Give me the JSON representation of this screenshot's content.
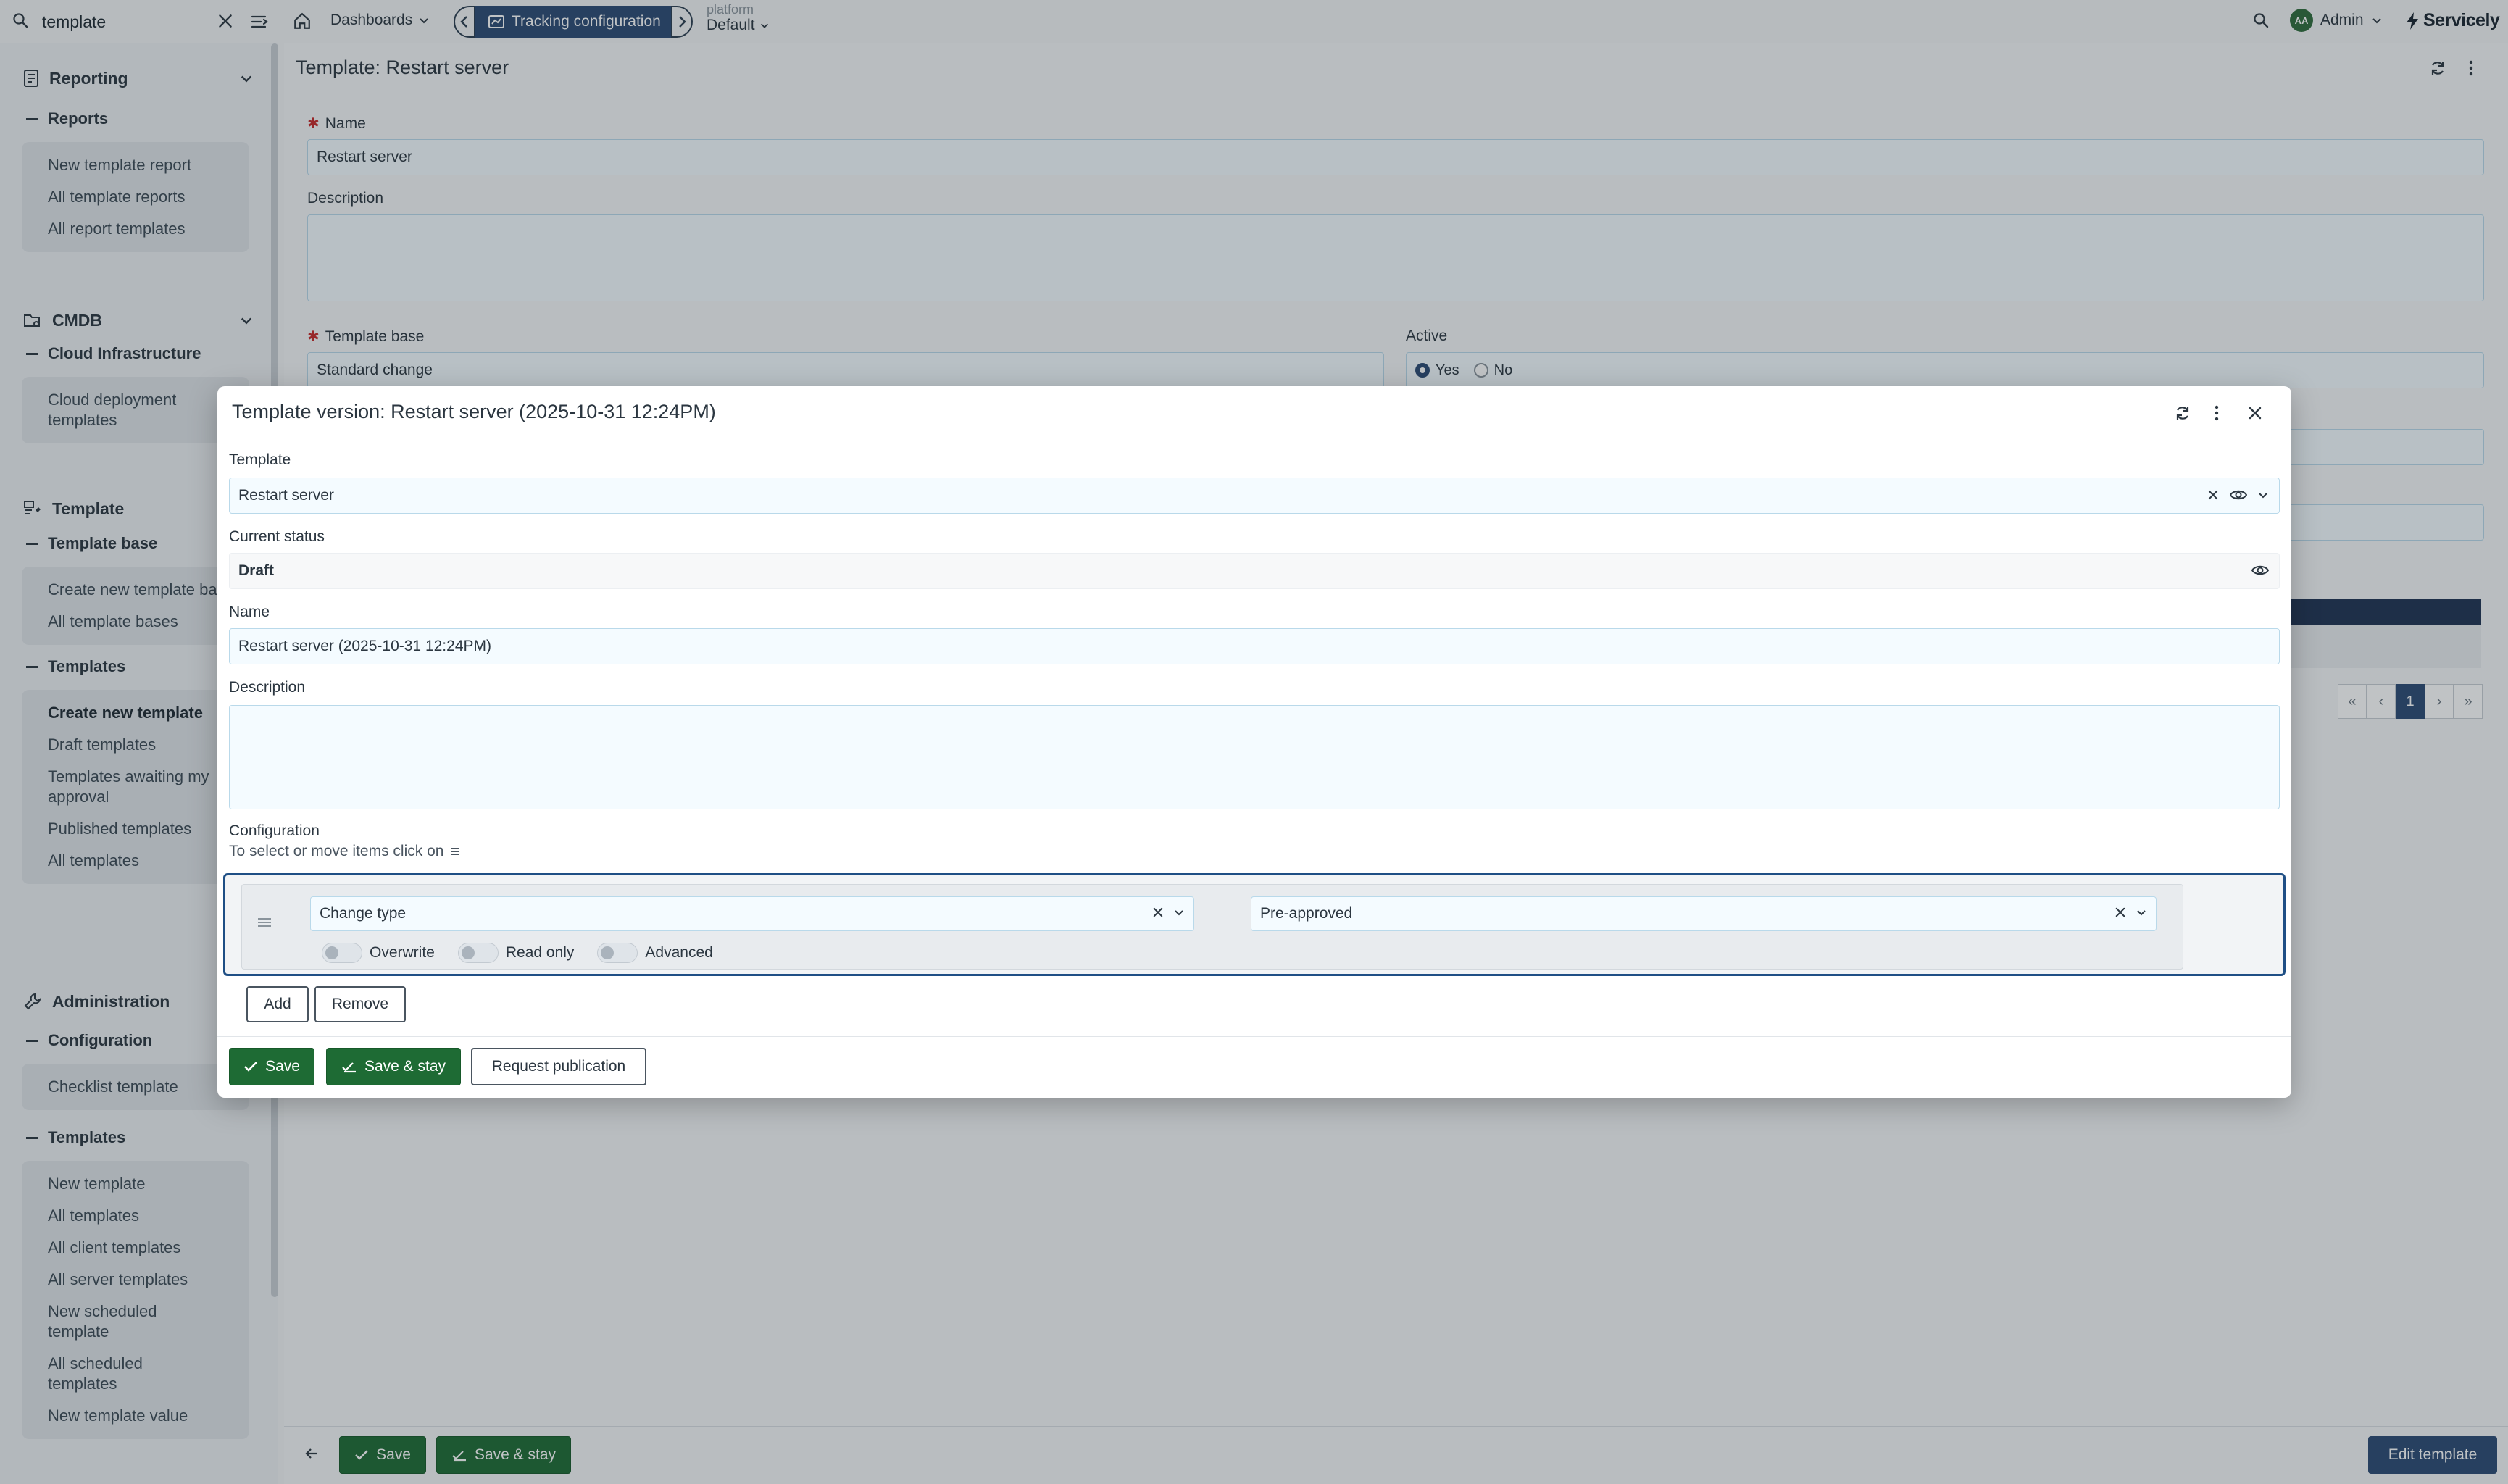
{
  "topbar": {
    "search": {
      "value": "template",
      "placeholder": ""
    },
    "dashboards_label": "Dashboards",
    "active_tab_label": "Tracking configuration",
    "platform": {
      "label": "platform",
      "value": "Default"
    },
    "user_initials": "AA",
    "user_label": "Admin",
    "logo_text": "Servicely"
  },
  "sidebar": {
    "reporting": {
      "title": "Reporting",
      "group": "Reports",
      "items": [
        "New template report",
        "All template reports",
        "All report templates"
      ]
    },
    "cmdb": {
      "title": "CMDB",
      "group": "Cloud Infrastructure",
      "items": [
        "Cloud deployment templates"
      ]
    },
    "template": {
      "title": "Template",
      "group1": "Template base",
      "group1_items": [
        "Create new template base",
        "All template bases"
      ],
      "group2": "Templates",
      "group2_items": [
        "Create new template",
        "Draft templates",
        "Templates awaiting my approval",
        "Published templates",
        "All templates"
      ]
    },
    "administration": {
      "title": "Administration",
      "group1": "Configuration",
      "group1_items": [
        "Checklist template"
      ],
      "group2": "Templates",
      "group2_items": [
        "New template",
        "All templates",
        "All client templates",
        "All server templates",
        "New scheduled template",
        "All scheduled templates",
        "New template value"
      ]
    }
  },
  "page": {
    "title": "Template: Restart server",
    "name_label": "Name",
    "name_value": "Restart server",
    "description_label": "Description",
    "template_base_label": "Template base",
    "template_base_value": "Standard change",
    "active_label": "Active",
    "active_yes": "Yes",
    "active_no": "No",
    "active_value": "Yes",
    "pagination_current": "1",
    "footer": {
      "save": "Save",
      "save_stay": "Save & stay",
      "edit_template": "Edit template"
    }
  },
  "modal": {
    "title": "Template version: Restart server (2025-10-31 12:24PM)",
    "template_label": "Template",
    "template_value": "Restart server",
    "status_label": "Current status",
    "status_value": "Draft",
    "name_label": "Name",
    "name_value": "Restart server (2025-10-31 12:24PM)",
    "description_label": "Description",
    "description_value": "",
    "config_label": "Configuration",
    "config_hint": "To select or move items click on",
    "config_rows": [
      {
        "field": "Change type",
        "value": "Pre-approved",
        "toggles": [
          {
            "label": "Overwrite",
            "on": false
          },
          {
            "label": "Read only",
            "on": false
          },
          {
            "label": "Advanced",
            "on": false
          }
        ]
      }
    ],
    "add_label": "Add",
    "remove_label": "Remove",
    "footer": {
      "save": "Save",
      "save_stay": "Save & stay",
      "request_publication": "Request publication"
    }
  },
  "colors": {
    "primary_green": "#1e6b34",
    "navy": "#2b4a73",
    "focus_border": "#1f4f85",
    "input_bg": "#f4fbff",
    "required": "#c62828"
  },
  "icons": [
    "search-icon",
    "close-icon",
    "menu-icon",
    "home-icon",
    "chevron-down-icon",
    "chevron-left-icon",
    "chevron-right-icon",
    "refresh-icon",
    "more-vertical-icon",
    "eye-icon",
    "drag-handle-icon",
    "check-icon",
    "check-double-icon",
    "arrow-left-icon",
    "report-icon",
    "cmdb-icon",
    "template-icon",
    "wrench-icon"
  ]
}
